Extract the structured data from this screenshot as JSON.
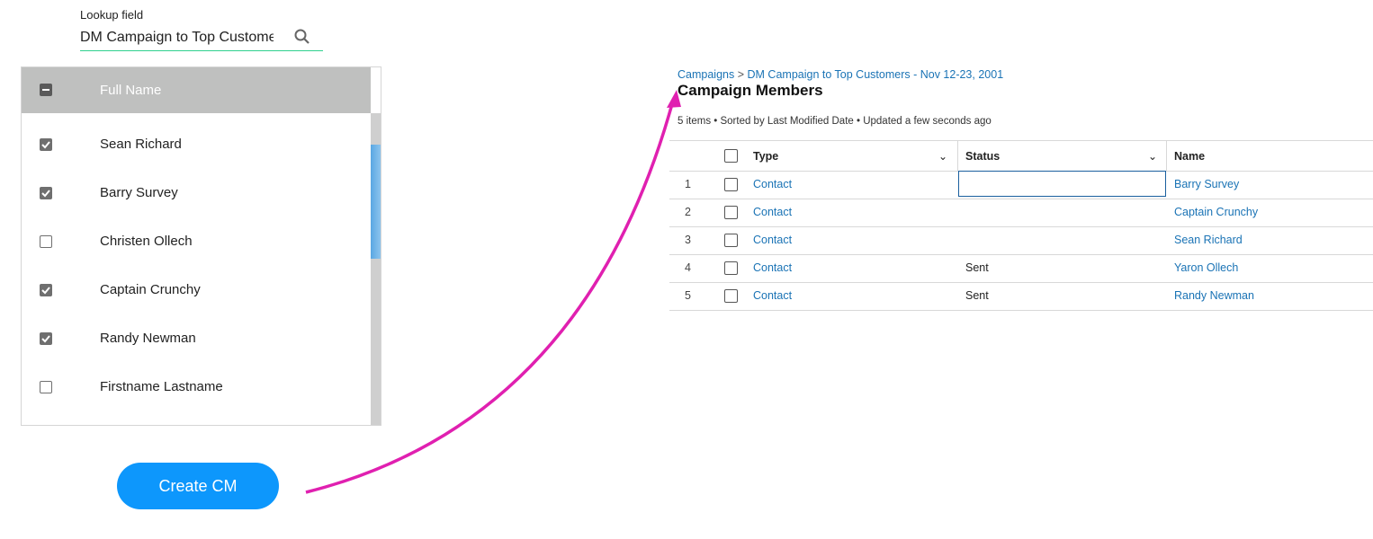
{
  "lookup": {
    "label": "Lookup field",
    "value": "DM Campaign to Top Customers",
    "icon": "search-icon"
  },
  "list": {
    "header": "Full Name",
    "header_checkbox": "indeterminate",
    "rows": [
      {
        "name": "Sean Richard",
        "checked": true
      },
      {
        "name": "Barry Survey",
        "checked": true
      },
      {
        "name": "Christen Ollech",
        "checked": false
      },
      {
        "name": "Captain Crunchy",
        "checked": true
      },
      {
        "name": "Randy Newman",
        "checked": true
      },
      {
        "name": "Firstname Lastname",
        "checked": false
      }
    ]
  },
  "create_button": "Create CM",
  "salesforce": {
    "breadcrumb": {
      "root": "Campaigns",
      "sep": ">",
      "current": "DM Campaign to Top Customers - Nov 12-23, 2001"
    },
    "title": "Campaign Members",
    "summary": "5 items • Sorted by Last Modified Date • Updated a few seconds ago",
    "columns": [
      "Type",
      "Status",
      "Name"
    ],
    "rows": [
      {
        "num": "1",
        "type": "Contact",
        "status": "",
        "name": "Barry Survey"
      },
      {
        "num": "2",
        "type": "Contact",
        "status": "",
        "name": "Captain Crunchy"
      },
      {
        "num": "3",
        "type": "Contact",
        "status": "",
        "name": "Sean Richard"
      },
      {
        "num": "4",
        "type": "Contact",
        "status": "Sent",
        "name": "Yaron Ollech"
      },
      {
        "num": "5",
        "type": "Contact",
        "status": "Sent",
        "name": "Randy Newman"
      }
    ]
  },
  "colors": {
    "accent": "#0d97fc",
    "link": "#1a73b5",
    "arrow": "#e020b0",
    "underline": "#2ed08f"
  }
}
